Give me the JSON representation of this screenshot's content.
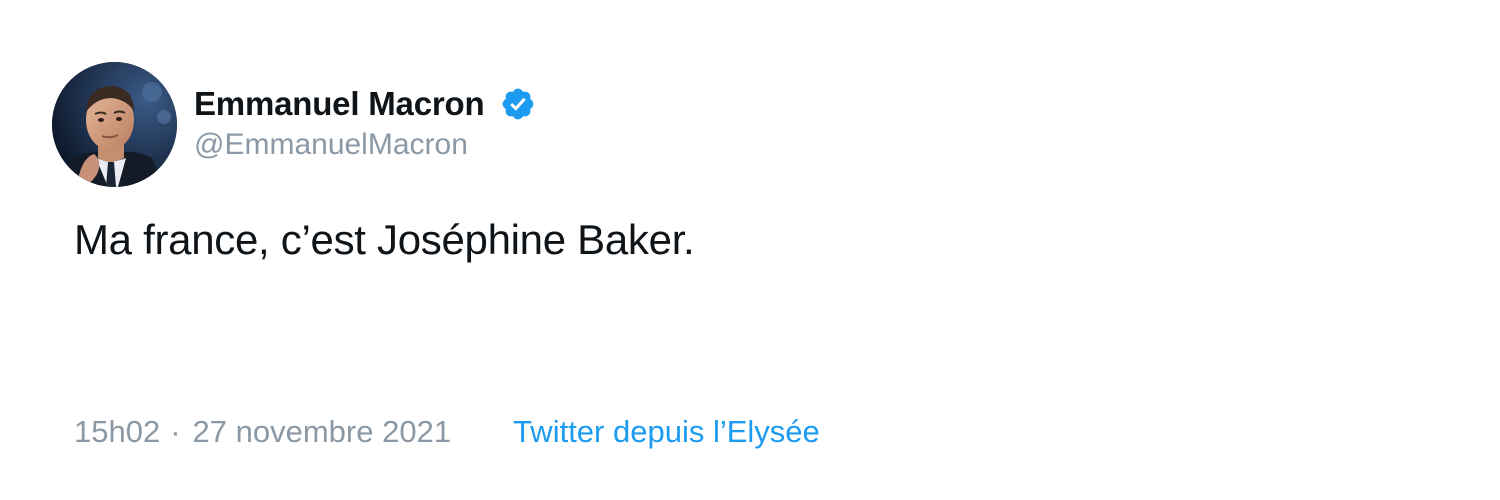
{
  "tweet": {
    "author": {
      "display_name": "Emmanuel Macron",
      "handle": "@EmmanuelMacron",
      "verified": true,
      "avatar_icon": "profile-photo",
      "badge_icon": "verified-badge-icon",
      "badge_color": "#1d9bf0"
    },
    "text": "Ma france, c’est Joséphine Baker.",
    "time": "15h02",
    "separator": "·",
    "date": "27 novembre 2021",
    "source": "Twitter depuis l’Elysée"
  },
  "colors": {
    "text_primary": "#0f1419",
    "text_secondary": "#8b98a5",
    "accent": "#1d9bf0",
    "background": "#ffffff"
  }
}
